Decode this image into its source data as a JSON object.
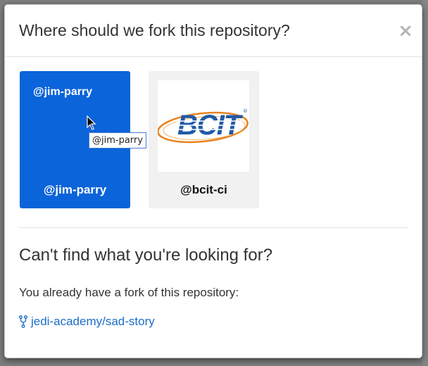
{
  "dialog": {
    "title": "Where should we fork this repository?",
    "close_glyph": "×"
  },
  "owners": [
    {
      "name": "@jim-parry",
      "avatar_alt": "@jim-parry",
      "selected": true
    },
    {
      "name": "@bcit-ci",
      "logo_text": "BCIT",
      "selected": false
    }
  ],
  "tooltip": "@jim-parry",
  "not_found": {
    "heading": "Can't find what you're looking for?",
    "message": "You already have a fork of this repository:",
    "fork_link": "jedi-academy/sad-story",
    "fork_icon": "repo-forked-icon"
  },
  "colors": {
    "selected_tile": "#0b64d9",
    "link": "#1a6dc8",
    "logo_blue": "#1f5aa8",
    "logo_orange": "#e8821e"
  }
}
